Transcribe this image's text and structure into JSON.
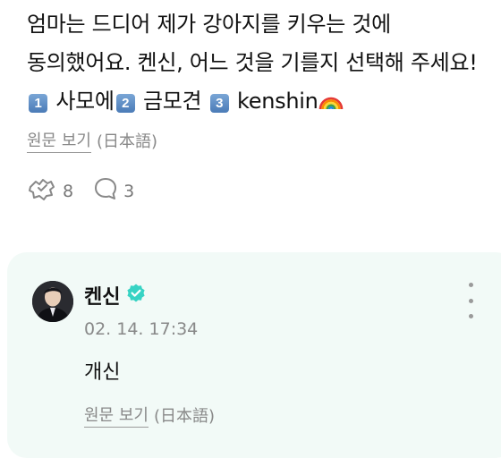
{
  "post": {
    "text_part1": "엄마는 드디어 제가 강아지를 키우는 것에 동의했어요. 켄신, 어느 것을 기를지 선택해 주세요! ",
    "badge1": "1",
    "option1": " 사모에",
    "badge2": "2",
    "option2": " 금모견 ",
    "badge3": "3",
    "option3": " kenshin",
    "emoji": "rainbow-emoji",
    "translate_link": "원문 보기",
    "translate_lang": "(日本語)",
    "likes_count": "8",
    "comments_count": "3"
  },
  "comment": {
    "author": "켄신",
    "verified": true,
    "timestamp": "02. 14. 17:34",
    "body": "개신",
    "translate_link": "원문 보기",
    "translate_lang": "(日本語)"
  },
  "colors": {
    "card_background": "#f2faf7",
    "verified_badge": "#37d3c4",
    "muted_text": "#888888"
  }
}
